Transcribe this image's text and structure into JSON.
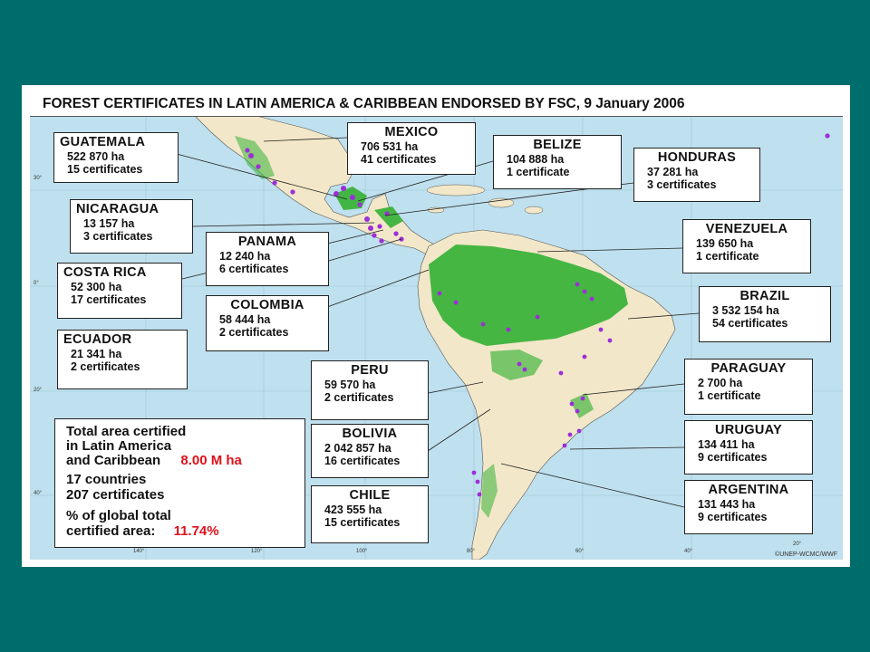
{
  "title": "FOREST CERTIFICATES IN LATIN AMERICA & CARIBBEAN ENDORSED BY FSC, 9 January 2006",
  "colors": {
    "ocean": "#bfe0ee",
    "land": "#f2e7c8",
    "forest": "#3cb43c",
    "certificate_dot": "#9b2fd8",
    "background": "#006d6d",
    "highlight": "#e0101a"
  },
  "countries": {
    "guatemala": {
      "name": "GUATEMALA",
      "ha": "522 870 ha",
      "certs": "15 certificates"
    },
    "mexico": {
      "name": "MEXICO",
      "ha": "706 531 ha",
      "certs": "41 certificates"
    },
    "belize": {
      "name": "BELIZE",
      "ha": "104 888 ha",
      "certs": "1 certificate"
    },
    "honduras": {
      "name": "HONDURAS",
      "ha": "37 281 ha",
      "certs": "3 certificates"
    },
    "nicaragua": {
      "name": "NICARAGUA",
      "ha": "13 157 ha",
      "certs": "3 certificates"
    },
    "venezuela": {
      "name": "VENEZUELA",
      "ha": "139 650 ha",
      "certs": "1 certificate"
    },
    "panama": {
      "name": "PANAMA",
      "ha": "12 240 ha",
      "certs": "6 certificates"
    },
    "costa_rica": {
      "name": "COSTA RICA",
      "ha": "52 300 ha",
      "certs": "17 certificates"
    },
    "colombia": {
      "name": "COLOMBIA",
      "ha": "58 444 ha",
      "certs": "2 certificates"
    },
    "brazil": {
      "name": "BRAZIL",
      "ha": "3 532 154 ha",
      "certs": "54 certificates"
    },
    "ecuador": {
      "name": "ECUADOR",
      "ha": "21 341 ha",
      "certs": "2 certificates"
    },
    "peru": {
      "name": "PERU",
      "ha": "59 570 ha",
      "certs": "2 certificates"
    },
    "paraguay": {
      "name": "PARAGUAY",
      "ha": "2 700 ha",
      "certs": "1 certificate"
    },
    "bolivia": {
      "name": "BOLIVIA",
      "ha": "2 042 857 ha",
      "certs": "16 certificates"
    },
    "uruguay": {
      "name": "URUGUAY",
      "ha": "134 411 ha",
      "certs": "9 certificates"
    },
    "chile": {
      "name": "CHILE",
      "ha": "423 555 ha",
      "certs": "15 certificates"
    },
    "argentina": {
      "name": "ARGENTINA",
      "ha": "131 443 ha",
      "certs": "9 certificates"
    }
  },
  "summary": {
    "line1": "Total area certified",
    "line2": "in Latin America",
    "line3": "and Caribbean",
    "total_area": "8.00 M ha",
    "countries": "17 countries",
    "certificates": "207 certificates",
    "pct_label1": "% of global total",
    "pct_label2": "certified area:",
    "pct_value": "11.74%"
  },
  "copyright": "©UNEP-WCMC/WWF",
  "ticks": {
    "lat_30": "30°",
    "lat_0": "0°",
    "lat_20": "20°",
    "lat_40": "40°",
    "lon_140": "140°",
    "lon_120": "120°",
    "lon_100": "100°",
    "lon_80": "80°",
    "lon_60": "60°",
    "lon_40": "40°",
    "lon_20": "20°"
  }
}
